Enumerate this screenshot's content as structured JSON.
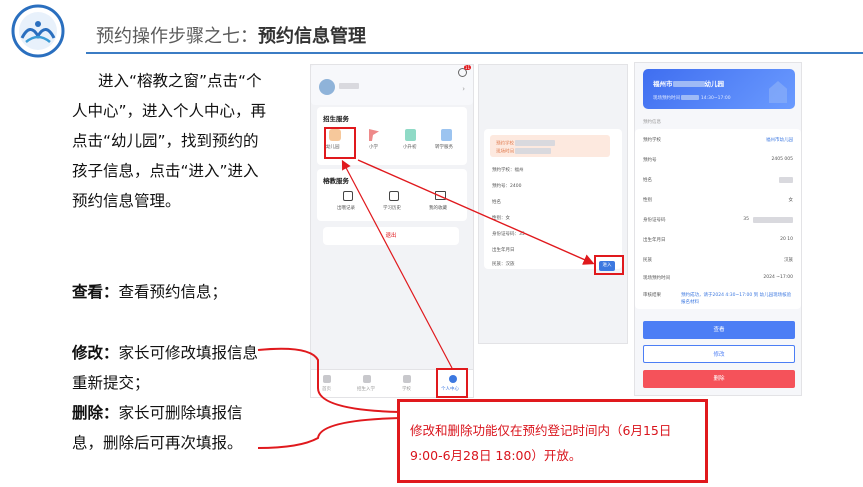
{
  "header": {
    "title_prefix": "预约操作步骤之七：",
    "title_main": "预约信息管理"
  },
  "left": {
    "intro": "进入“榕教之窗”点击“个人中心”，进入个人中心，再点击“幼儿园”，找到预约的孩子信息，点击“进入”进入预约信息管理。",
    "view_label": "查看：",
    "view_text": "查看预约信息；",
    "edit_label": "修改：",
    "edit_text": "家长可修改填报信息重新提交；",
    "delete_label": "删除：",
    "delete_text": "家长可删除填报信息，删除后可再次填报。"
  },
  "note": "修改和删除功能仅在预约登记时间内（6月15日 9:00-6月28日 18:00）开放。",
  "screen1": {
    "badge": "11",
    "enroll_title": "招生服务",
    "enroll_items": [
      "幼儿园",
      "小学",
      "小升初",
      "转学服务"
    ],
    "rongjiao_title": "榕教服务",
    "rongjiao_items": [
      "出哦记录",
      "学习历史",
      "我的收藏"
    ],
    "logout": "退出",
    "tabs": [
      "首页",
      "招生入学",
      "学校",
      "个人中心"
    ]
  },
  "screen2": {
    "lines": [
      "预约学校：福州",
      "预约号：2400",
      "姓名",
      "性别：女",
      "身份证号码：35",
      "出生年月日",
      "民族：汉族"
    ],
    "enter_button": "进入"
  },
  "screen3": {
    "banner_city": "福州市",
    "banner_suffix": "幼儿园",
    "banner_time": "14:30~17:00",
    "section": "预约信息",
    "rows": [
      {
        "label": "预约学校",
        "value": "福州市幼儿园"
      },
      {
        "label": "预约号",
        "value": "2405 005"
      },
      {
        "label": "姓名",
        "value": ""
      },
      {
        "label": "性别",
        "value": "女"
      },
      {
        "label": "身份证号码",
        "value": "35"
      },
      {
        "label": "出生年月日",
        "value": "20 10"
      },
      {
        "label": "民族",
        "value": "汉族"
      },
      {
        "label": "现场预约时间",
        "value": "2024 ~17:00"
      }
    ],
    "review_label": "审核结果",
    "review_value": "预约成功，请于2024 4:30~17:00 到 幼儿园现场核验报名材料",
    "btn_view": "查看",
    "btn_edit": "修改",
    "btn_delete": "删除"
  },
  "colors": {
    "accent": "#3b7cc4",
    "red": "#e0191d",
    "primary_btn": "#4c7ef5",
    "delete_btn": "#f5525a"
  }
}
